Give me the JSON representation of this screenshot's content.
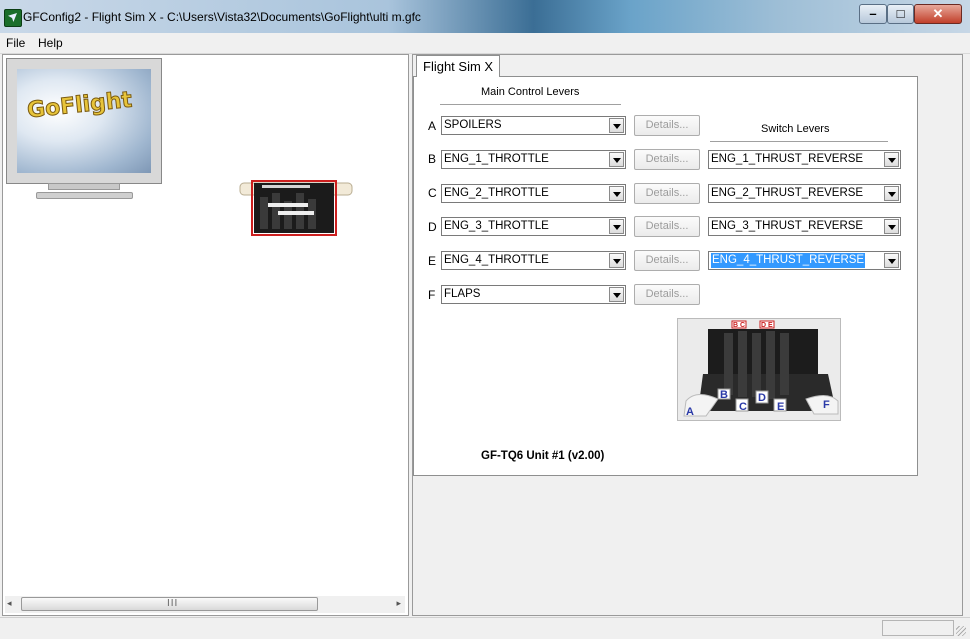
{
  "window": {
    "title": "GFConfig2 - Flight Sim X - C:\\Users\\Vista32\\Documents\\GoFlight\\ulti m.gfc",
    "min_glyph": "–",
    "max_glyph": "□",
    "close_glyph": "✕"
  },
  "menu": {
    "items": [
      "File",
      "Help"
    ]
  },
  "left_pane": {
    "logo_text": "GoFlight",
    "scroll_grip": "III",
    "scroll_left": "◂",
    "scroll_right": "▸"
  },
  "tab": {
    "label": "Flight Sim X"
  },
  "main_levers": {
    "heading": "Main Control Levers",
    "rows": [
      {
        "letter": "A",
        "value": "SPOILERS",
        "details": "Details..."
      },
      {
        "letter": "B",
        "value": "ENG_1_THROTTLE",
        "details": "Details..."
      },
      {
        "letter": "C",
        "value": "ENG_2_THROTTLE",
        "details": "Details..."
      },
      {
        "letter": "D",
        "value": "ENG_3_THROTTLE",
        "details": "Details..."
      },
      {
        "letter": "E",
        "value": "ENG_4_THROTTLE",
        "details": "Details..."
      },
      {
        "letter": "F",
        "value": "FLAPS",
        "details": "Details..."
      }
    ]
  },
  "switch_levers": {
    "heading": "Switch Levers",
    "rows": [
      {
        "value": "ENG_1_THRUST_REVERSE"
      },
      {
        "value": "ENG_2_THRUST_REVERSE"
      },
      {
        "value": "ENG_3_THRUST_REVERSE"
      },
      {
        "value": "ENG_4_THRUST_REVERSE",
        "selected": true
      }
    ]
  },
  "preview": {
    "labels": [
      "A",
      "B",
      "C",
      "D",
      "E",
      "F"
    ],
    "top_labels": [
      "B",
      "C",
      "D",
      "E"
    ]
  },
  "unit_label": "GF-TQ6 Unit #1 (v2.00)",
  "colors": {
    "selection": "#3399ff",
    "lever_red": "#cc1f1f",
    "label_blue": "#2b3aa8"
  }
}
